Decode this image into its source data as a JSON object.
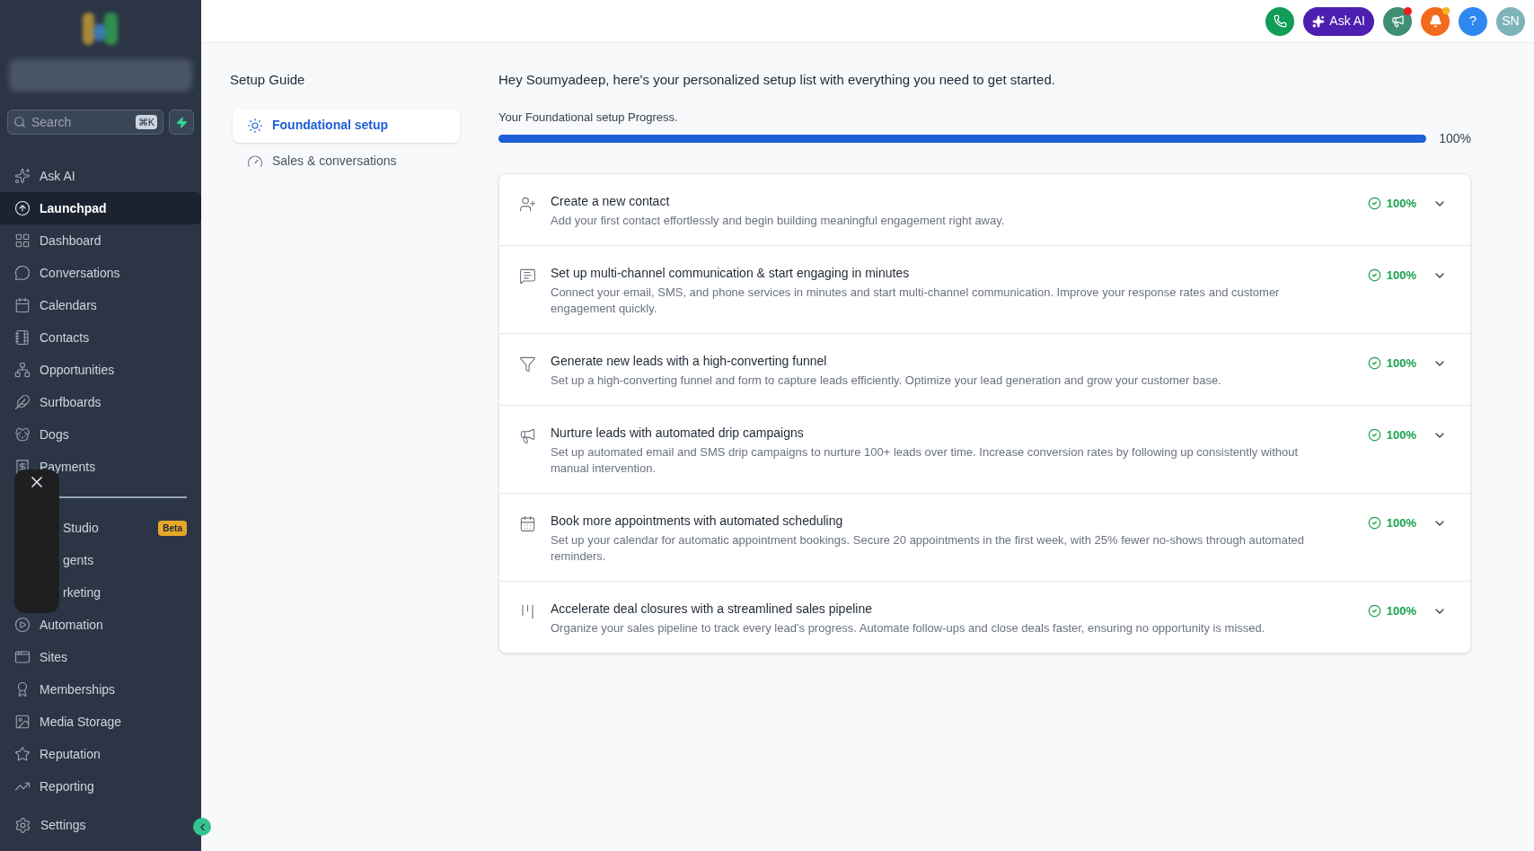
{
  "sidebar": {
    "search": {
      "placeholder": "Search",
      "shortcut": "⌘K"
    },
    "items": [
      {
        "kind": "link",
        "label": "Ask AI",
        "selected": false
      },
      {
        "kind": "link",
        "label": "Launchpad",
        "selected": true
      },
      {
        "kind": "link",
        "label": "Dashboard",
        "selected": false
      },
      {
        "kind": "link",
        "label": "Conversations",
        "selected": false
      },
      {
        "kind": "link",
        "label": "Calendars",
        "selected": false
      },
      {
        "kind": "link",
        "label": "Contacts",
        "selected": false
      },
      {
        "kind": "link",
        "label": "Opportunities",
        "selected": false
      },
      {
        "kind": "link",
        "label": "Surfboards",
        "selected": false
      },
      {
        "kind": "link",
        "label": "Dogs",
        "selected": false
      },
      {
        "kind": "link",
        "label": "Payments",
        "selected": false
      },
      {
        "kind": "divider"
      },
      {
        "kind": "covered",
        "label": "Studio",
        "badge": "Beta",
        "selected": false
      },
      {
        "kind": "covered",
        "label": "gents",
        "selected": false
      },
      {
        "kind": "covered",
        "label": "rketing",
        "selected": false
      },
      {
        "kind": "link",
        "label": "Automation",
        "selected": false
      },
      {
        "kind": "link",
        "label": "Sites",
        "selected": false
      },
      {
        "kind": "link",
        "label": "Memberships",
        "selected": false
      },
      {
        "kind": "link",
        "label": "Media Storage",
        "selected": false
      },
      {
        "kind": "link",
        "label": "Reputation",
        "selected": false
      },
      {
        "kind": "link",
        "label": "Reporting",
        "selected": false
      }
    ],
    "settings": "Settings"
  },
  "header": {
    "ask_ai": "Ask AI",
    "help": "?",
    "avatar": "SN",
    "announcements_unread": true,
    "notifications_unread": true
  },
  "guide": {
    "title": "Setup Guide",
    "tabs": [
      {
        "label": "Foundational setup",
        "selected": true
      },
      {
        "label": "Sales & conversations",
        "selected": false
      }
    ]
  },
  "greeting": "Hey Soumyadeep, here's your personalized setup list with everything you need to get started.",
  "progress": {
    "label": "Your Foundational setup Progress.",
    "level": 1,
    "reading": "100%"
  },
  "tasks": [
    {
      "title": "Create a new contact",
      "description": "Add your first contact effortlessly and begin building meaningful engagement right away.",
      "done": true,
      "percent": "100%",
      "expanded": false
    },
    {
      "title": "Set up multi-channel communication & start engaging in minutes",
      "description": "Connect your email, SMS, and phone services in minutes and start multi-channel communication. Improve your response rates and customer engagement quickly.",
      "done": true,
      "percent": "100%",
      "expanded": false
    },
    {
      "title": "Generate new leads with a high-converting funnel",
      "description": "Set up a high-converting funnel and form to capture leads efficiently. Optimize your lead generation and grow your customer base.",
      "done": true,
      "percent": "100%",
      "expanded": false
    },
    {
      "title": "Nurture leads with automated drip campaigns",
      "description": "Set up automated email and SMS drip campaigns to nurture 100+ leads over time. Increase conversion rates by following up consistently without manual intervention.",
      "done": true,
      "percent": "100%",
      "expanded": false
    },
    {
      "title": "Book more appointments with automated scheduling",
      "description": "Set up your calendar for automatic appointment bookings. Secure 20 appointments in the first week, with 25% fewer no-shows through automated reminders.",
      "done": true,
      "percent": "100%",
      "expanded": false
    },
    {
      "title": "Accelerate deal closures with a streamlined sales pipeline",
      "description": "Organize your sales pipeline to track every lead’s progress. Automate follow-ups and close deals faster, ensuring no opportunity is missed.",
      "done": true,
      "percent": "100%",
      "expanded": false
    }
  ]
}
